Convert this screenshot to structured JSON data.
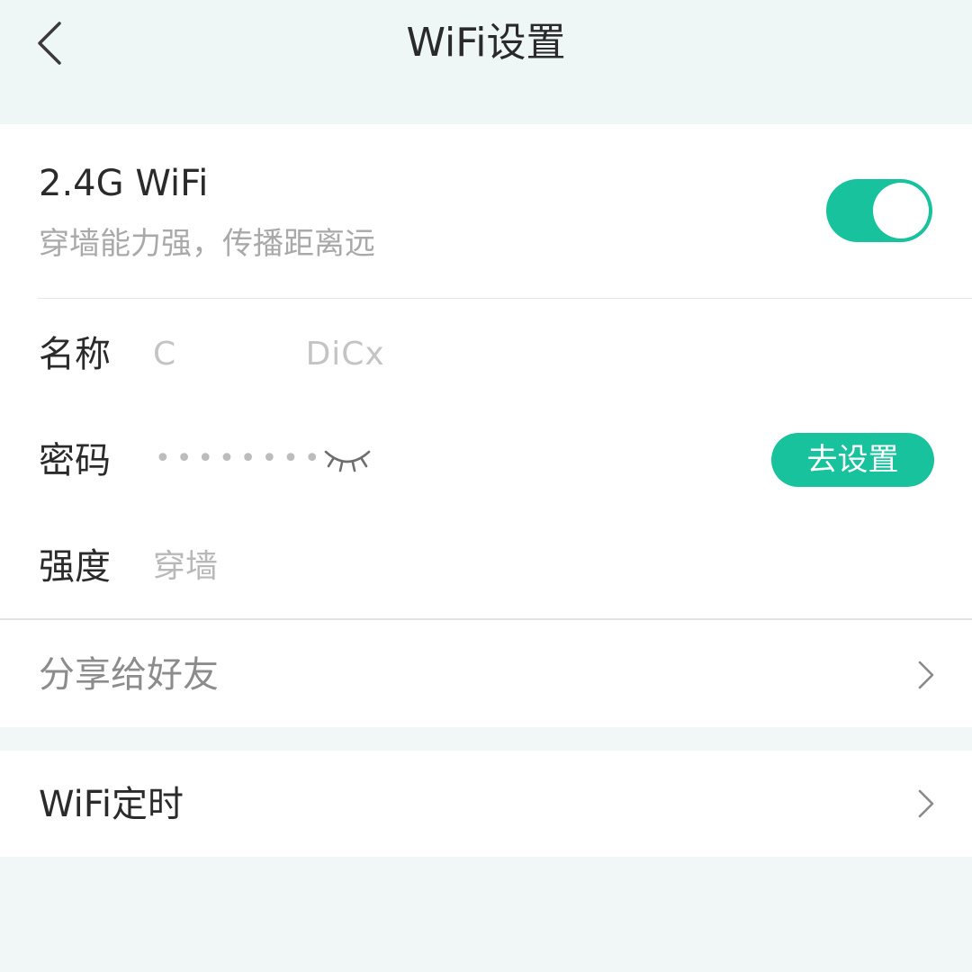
{
  "header": {
    "title": "WiFi设置",
    "back_icon": "chevron-left-icon"
  },
  "wifi_band": {
    "name": "2.4G WiFi",
    "description": "穿墙能力强，传播距离远",
    "enabled": true,
    "toggle_color": "#18c29c"
  },
  "details": {
    "name_label": "名称",
    "name_value": "C      DiCx",
    "password_label": "密码",
    "password_mask": "••••••••",
    "eye_icon": "eye-closed-icon",
    "set_button_label": "去设置",
    "strength_label": "强度",
    "strength_value": "穿墙"
  },
  "share": {
    "label": "分享给好友",
    "icon": "chevron-right-icon"
  },
  "timer": {
    "label": "WiFi定时",
    "icon": "chevron-right-icon"
  },
  "colors": {
    "accent": "#18c29c",
    "background": "#f1f7f6"
  }
}
